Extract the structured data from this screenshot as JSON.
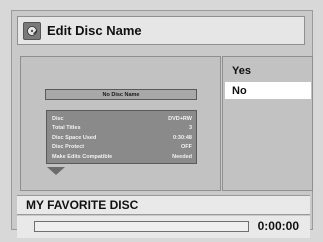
{
  "dialog": {
    "title": "Edit Disc Name",
    "icon": "disc-edit-icon"
  },
  "preview": {
    "disc_name_placeholder": "No Disc Name",
    "info": [
      {
        "label": "Disc",
        "value": "DVD+RW"
      },
      {
        "label": "Total Titles",
        "value": "3"
      },
      {
        "label": "Disc Space Used",
        "value": "0:30:48"
      },
      {
        "label": "Disc Protect",
        "value": "OFF"
      },
      {
        "label": "Make Edits Compatible",
        "value": "Needed"
      }
    ]
  },
  "options": {
    "yes": "Yes",
    "no": "No",
    "selected": "No"
  },
  "footer": {
    "disc_name": "MY FAVORITE DISC",
    "progress_fraction": 0,
    "time": "0:00:00"
  },
  "colors": {
    "background": "#d8d8d8",
    "highlight": "#ffffff",
    "info_box": "#8a8a8a"
  }
}
